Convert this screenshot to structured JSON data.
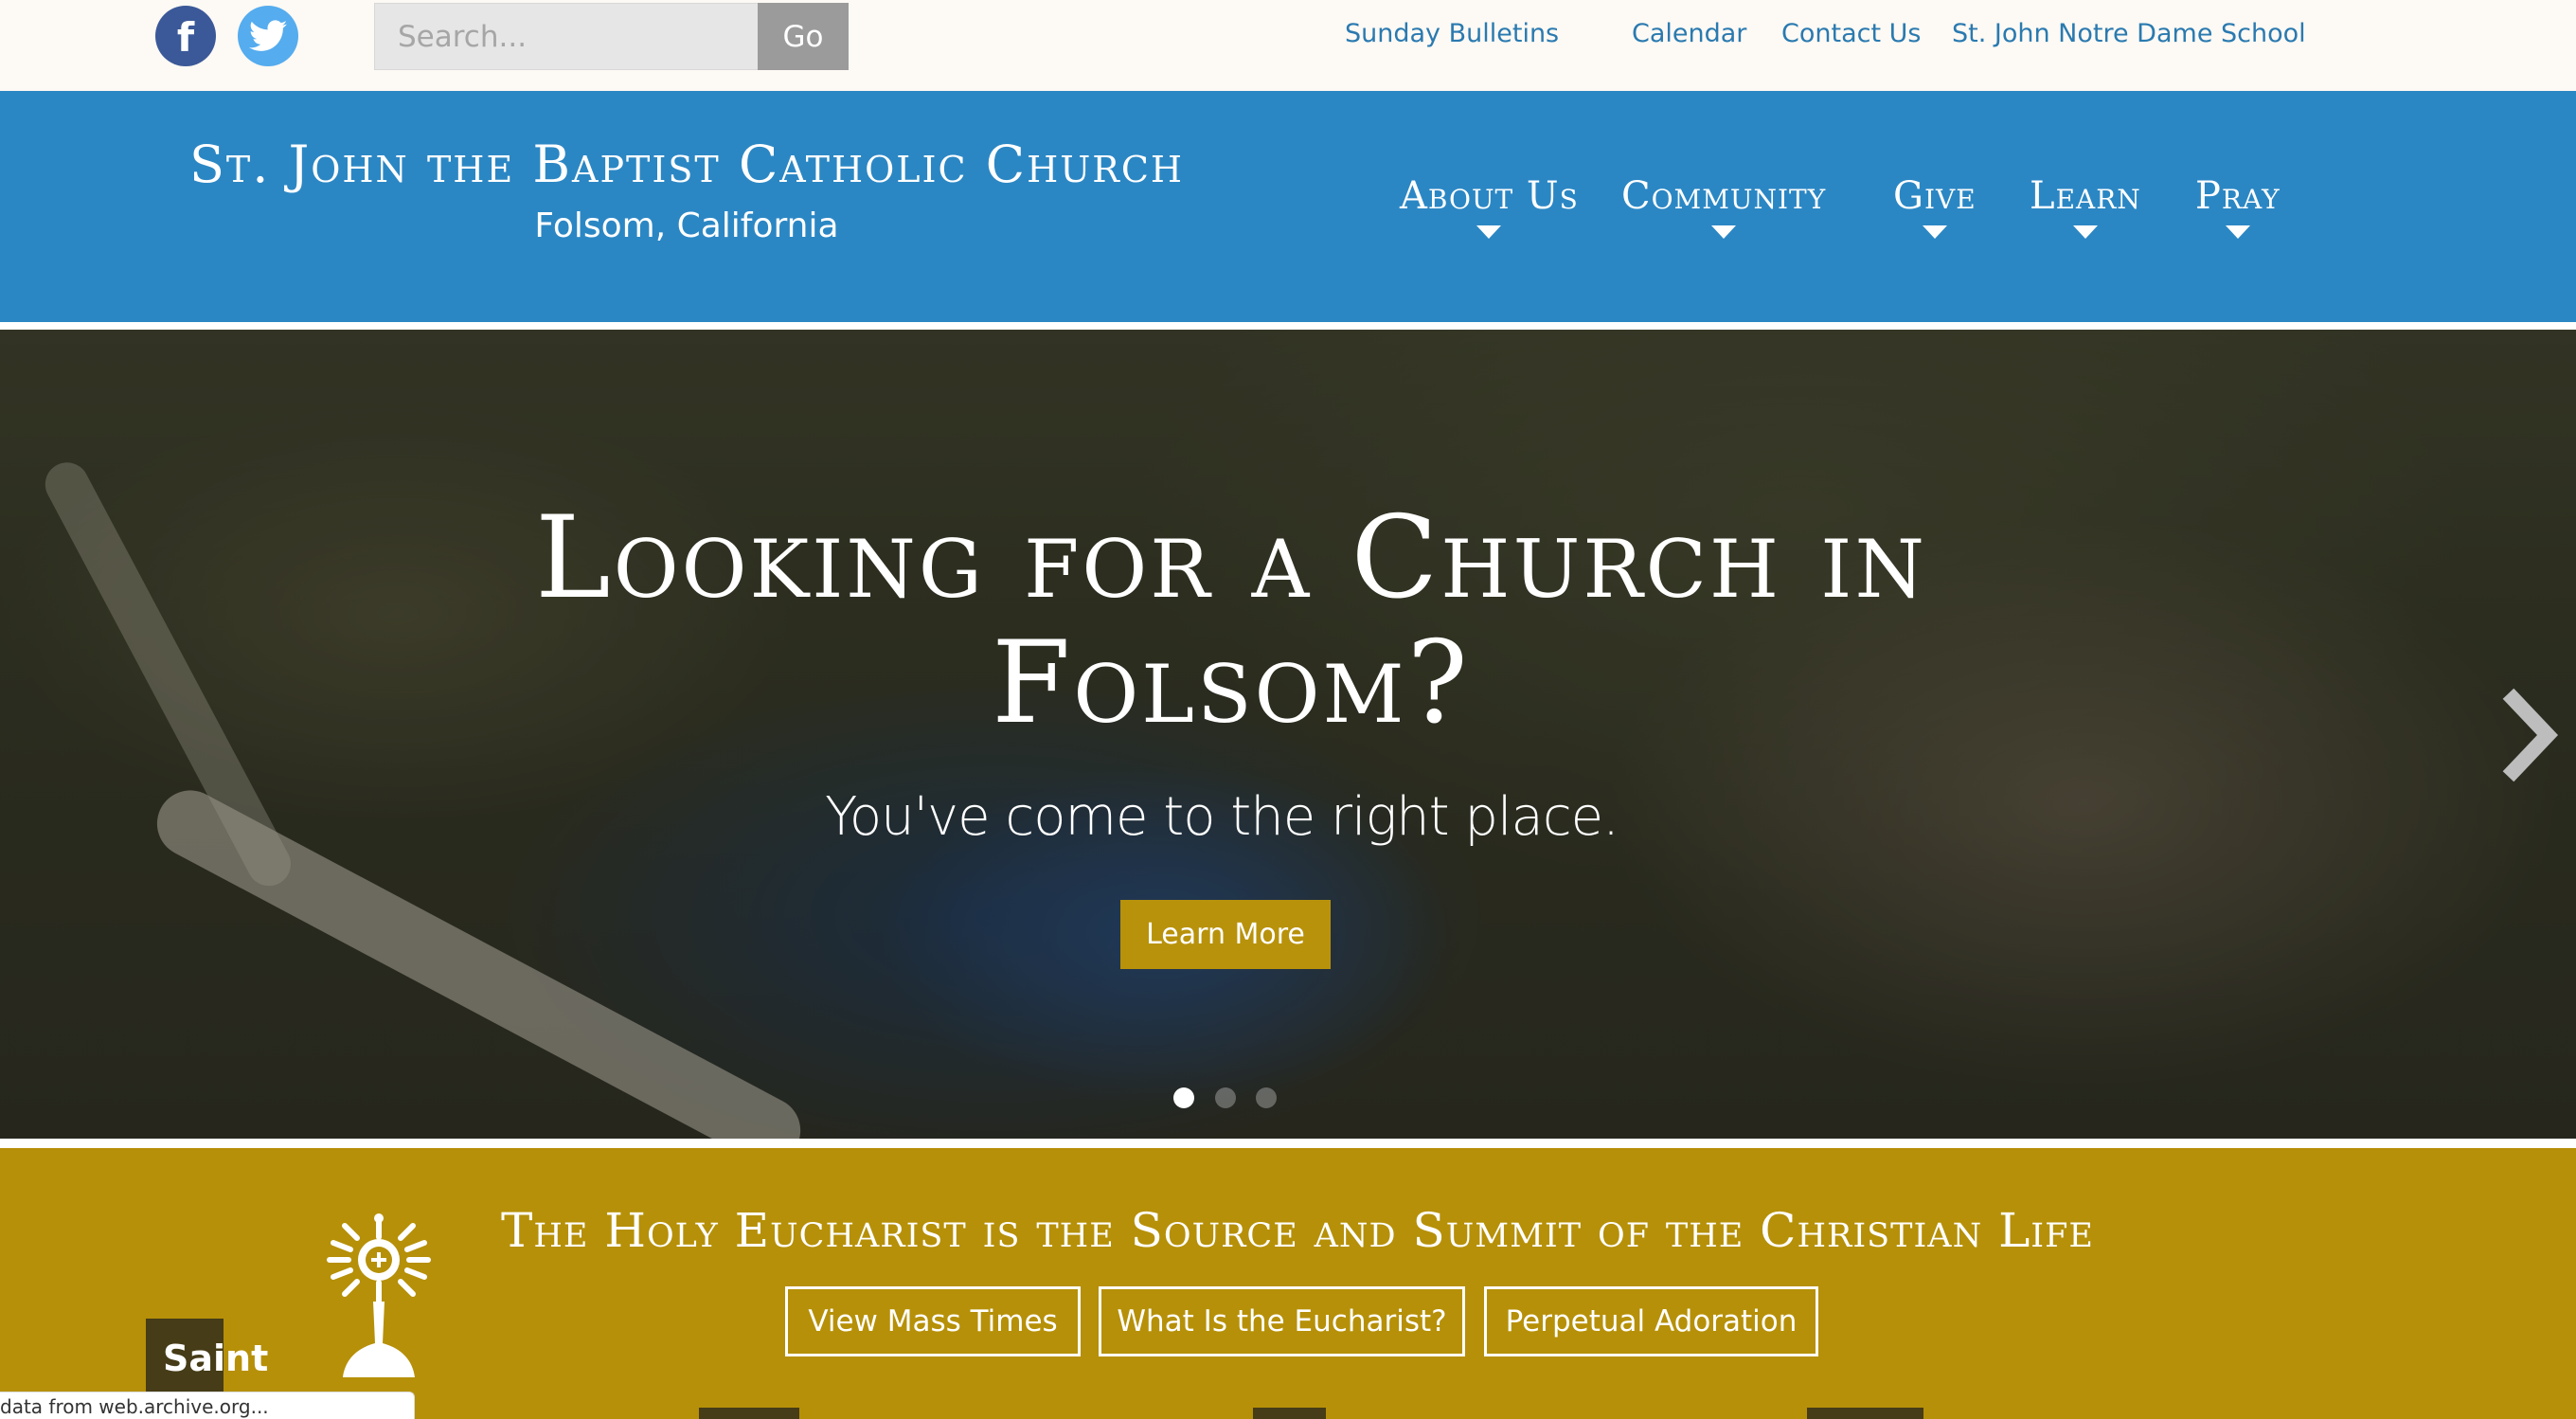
{
  "topbar": {
    "social": [
      {
        "name": "facebook-icon",
        "glyph": "f"
      },
      {
        "name": "twitter-icon",
        "glyph": "bird"
      }
    ],
    "search": {
      "placeholder": "Search...",
      "value": ""
    },
    "go_label": "Go",
    "links": [
      "Sunday Bulletins",
      "Calendar",
      "Contact Us",
      "St. John Notre Dame School"
    ]
  },
  "header": {
    "title": "St. John the Baptist Catholic Church",
    "subtitle": "Folsom, California",
    "nav": [
      "About Us",
      "Community",
      "Give",
      "Learn",
      "Pray"
    ]
  },
  "hero": {
    "title": "Looking for a Church in Folsom?",
    "subtitle": "You've come to the right place.",
    "button": "Learn More",
    "slides": 3,
    "active_slide": 1,
    "next_icon": "chevron-right-icon"
  },
  "eucharist": {
    "title": "The Holy Eucharist is the Source and Summit of the Christian Life",
    "buttons": [
      "View Mass Times",
      "What Is the Eucharist?",
      "Perpetual Adoration"
    ],
    "icon": "monstrance-icon",
    "saint_label": "Saint"
  },
  "status_bar": {
    "text": "data from web.archive.org..."
  },
  "colors": {
    "topbar_bg": "#fdf9f4",
    "link": "#2a7ab0",
    "header_bg": "#2b87c4",
    "gold": "#b69008",
    "hero_button": "#b8920b",
    "dark_tab": "#463c17"
  }
}
